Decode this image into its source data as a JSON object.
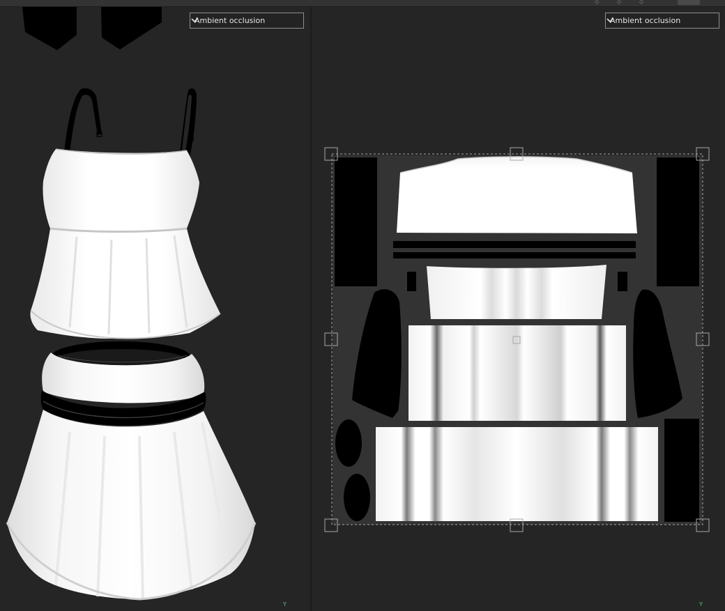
{
  "viewport_3d": {
    "channel": "Ambient occlusion",
    "axis_label": "Y"
  },
  "viewport_uv": {
    "channel": "Ambient occlusion",
    "axis_label": "Y"
  },
  "colors": {
    "background": "#252525",
    "uv_tile": "#333333",
    "axis": "#52c67a",
    "ao_light": "#ffffff",
    "ao_dark": "#000000"
  }
}
